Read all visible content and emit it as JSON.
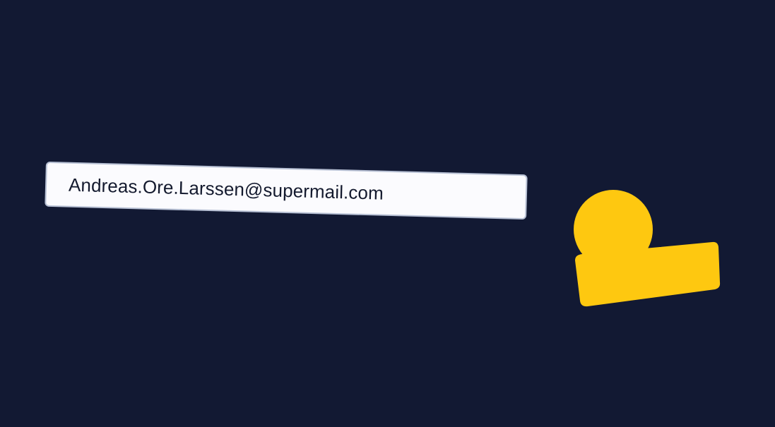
{
  "email_input": {
    "value": "Andreas.Ore.Larssen@supermail.com"
  },
  "glyph": {
    "icon": "user-icon",
    "color": "#fec810"
  },
  "colors": {
    "background": "#121933",
    "field_background": "#fbfbfe",
    "field_border": "#b7c0d4",
    "text": "#141a2e"
  }
}
